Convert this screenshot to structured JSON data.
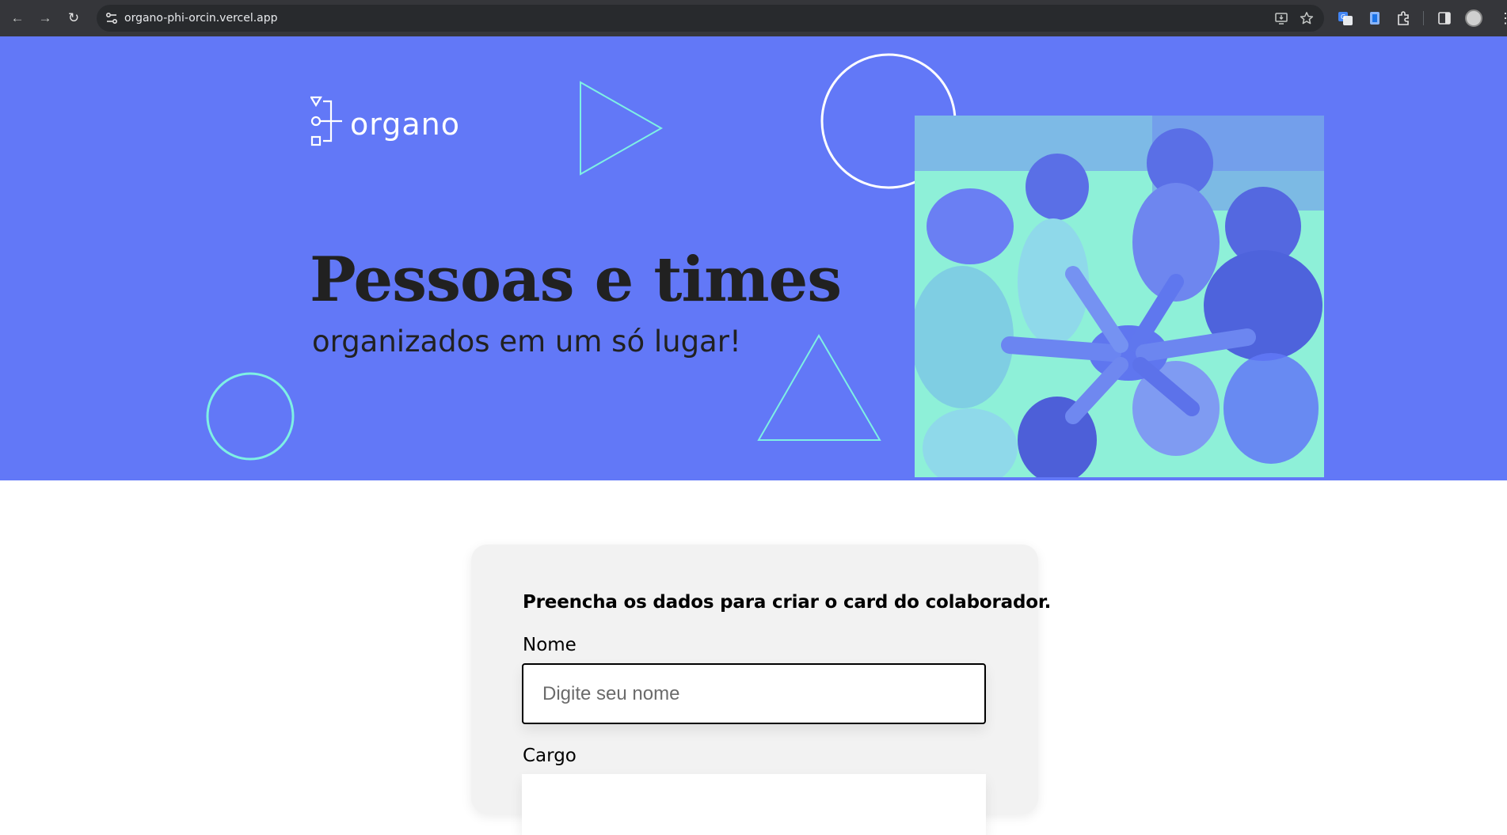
{
  "browser": {
    "url": "organo-phi-orcin.vercel.app"
  },
  "banner": {
    "logo_text": "organo",
    "headline": "Pessoas e times",
    "subheadline": "organizados em um só lugar!",
    "bg_color": "#6278f7",
    "photo_tint": "#8ef0d8"
  },
  "form": {
    "title": "Preencha os dados para criar o card do colaborador.",
    "fields": [
      {
        "label": "Nome",
        "placeholder": "Digite seu nome",
        "value": ""
      },
      {
        "label": "Cargo",
        "placeholder": "",
        "value": ""
      }
    ]
  }
}
